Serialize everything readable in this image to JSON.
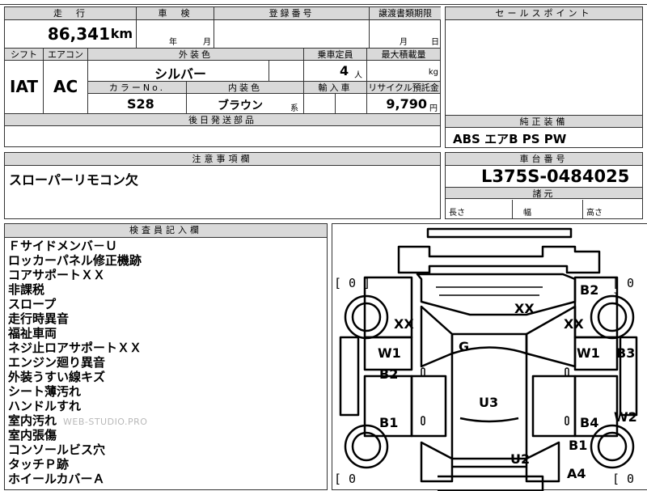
{
  "top_row": {
    "mileage_header": "走　行",
    "mileage_value": "86,341",
    "mileage_unit": "km",
    "inspection_header": "車　検",
    "inspection_year_unit": "年",
    "inspection_month_unit": "月",
    "registration_header": "登録番号",
    "transfer_header": "譲渡書類期限",
    "transfer_month_unit": "月",
    "transfer_day_unit": "日",
    "salespoint_header": "セールスポイント"
  },
  "vehicle_row": {
    "shift_header": "シフト",
    "shift_value": "IAT",
    "aircon_header": "エアコン",
    "aircon_value": "AC",
    "exterior_color_header": "外装色",
    "exterior_color_value": "シルバー",
    "capacity_header": "乗車定員",
    "capacity_value": "4",
    "capacity_unit": "人",
    "max_load_header": "最大積載量",
    "max_load_unit": "kg",
    "color_no_header": "カラーNo.",
    "color_no_value": "S28",
    "interior_color_header": "内装色",
    "interior_color_value": "ブラウン",
    "interior_color_suffix": "系",
    "import_header": "輸入車",
    "recycle_header": "リサイクル預託金",
    "recycle_value": "9,790",
    "recycle_unit": "円",
    "later_parts_header": "後日発送部品"
  },
  "equipment": {
    "header": "純正装備",
    "value": "ABS エアB PS PW"
  },
  "notes": {
    "header": "注意事項欄",
    "value": "スローパーリモコン欠"
  },
  "chassis": {
    "header": "車台番号",
    "value": "L375S-0484025",
    "dimensions_header": "諸元",
    "length_label": "長さ",
    "width_label": "幅",
    "height_label": "高さ"
  },
  "inspector": {
    "header": "検査員記入欄",
    "items": [
      "Ｆサイドメンバ－Ｕ",
      "ロッカーパネル修正機跡",
      "コアサポートＸＸ",
      "非課税",
      "スロープ",
      "走行時異音",
      "福祉車両",
      "ネジ止ロアサポートＸＸ",
      "エンジン廻り異音",
      "外装うすい線キズ",
      "シート薄汚れ",
      "ハンドルすれ",
      "室内汚れ",
      "室内張傷",
      "コンソールビス穴",
      "タッチＰ跡",
      "ホイールカバーＡ"
    ],
    "watermark": "WEB-STUDIO.PRO"
  },
  "diagram": {
    "marks": {
      "XX_center": "XX",
      "XX_left": "XX",
      "XX_right": "XX",
      "B2_top": "B2",
      "G": "G",
      "W1_left": "W1",
      "W1_right": "W1",
      "B3": "B3",
      "B2_left": "B2",
      "U3": "U3",
      "B1_left": "B1",
      "B4": "B4",
      "W2": "W2",
      "B1_right": "B1",
      "U2": "U2",
      "A4": "A4"
    },
    "counters": {
      "top_left": "[ 0 ]",
      "top_right": "[ 0 ]",
      "bottom_left": "[ 0",
      "bottom_right": "[ 0"
    }
  }
}
